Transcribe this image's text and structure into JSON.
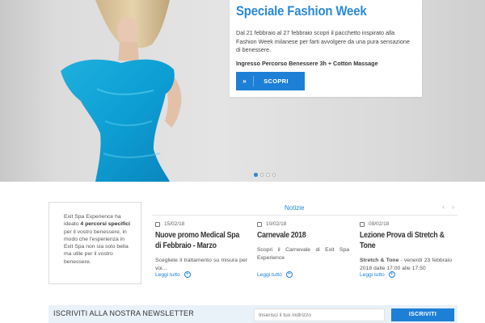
{
  "hero": {
    "slide_title": "Speciale Fashion Week",
    "slide_text": "Dal 21 febbraio al 27 febbraio scopri il pacchetto inspirato alla Fashion Week milanese per farti avvolgere da una pura sensazione di benessere.",
    "slide_subtitle": "Ingresso Percorso Benessere 3h + Cotton Massage",
    "cta_arrow": "»",
    "cta_label": "SCOPRI",
    "active_slide": 1,
    "slide_count": 4,
    "accent_color": "#1e7fd6"
  },
  "intro": {
    "text_before": "Exit Spa Experience ha ideato ",
    "text_bold": "4 percorsi specifici",
    "text_after": " per il vostro benessere, in modo che l'esperienza in Exit Spa non sia solo bella ma utile per il vostro benessere."
  },
  "news": {
    "section_title": "Notizie",
    "prev_icon": "‹",
    "next_icon": "›",
    "items": [
      {
        "date": "15/02/18",
        "title": "Nuove promo Medical Spa di Febbraio - Marzo",
        "text": "Scegliete il trattamento su misura per voi...",
        "link": "Leggi tutto"
      },
      {
        "date": "10/02/18",
        "title": "Carnevale 2018",
        "text": "Scopri il Carnevale di Exit Spa Experience",
        "link": "Leggi tutto"
      },
      {
        "date": "09/02/18",
        "title": "Lezione Prova di Stretch & Tone",
        "text_bold": "Stretch & Tone",
        "text": " - venerdì 23 febbraio 2018 dalle 17.00 alle 17.50",
        "link": "Leggi tutto"
      }
    ]
  },
  "newsletter": {
    "label": "ISCRIVITI ALLA NOSTRA NEWSLETTER",
    "placeholder": "Inserisci il tuo indirizzo",
    "button": "ISCRIVITI"
  }
}
